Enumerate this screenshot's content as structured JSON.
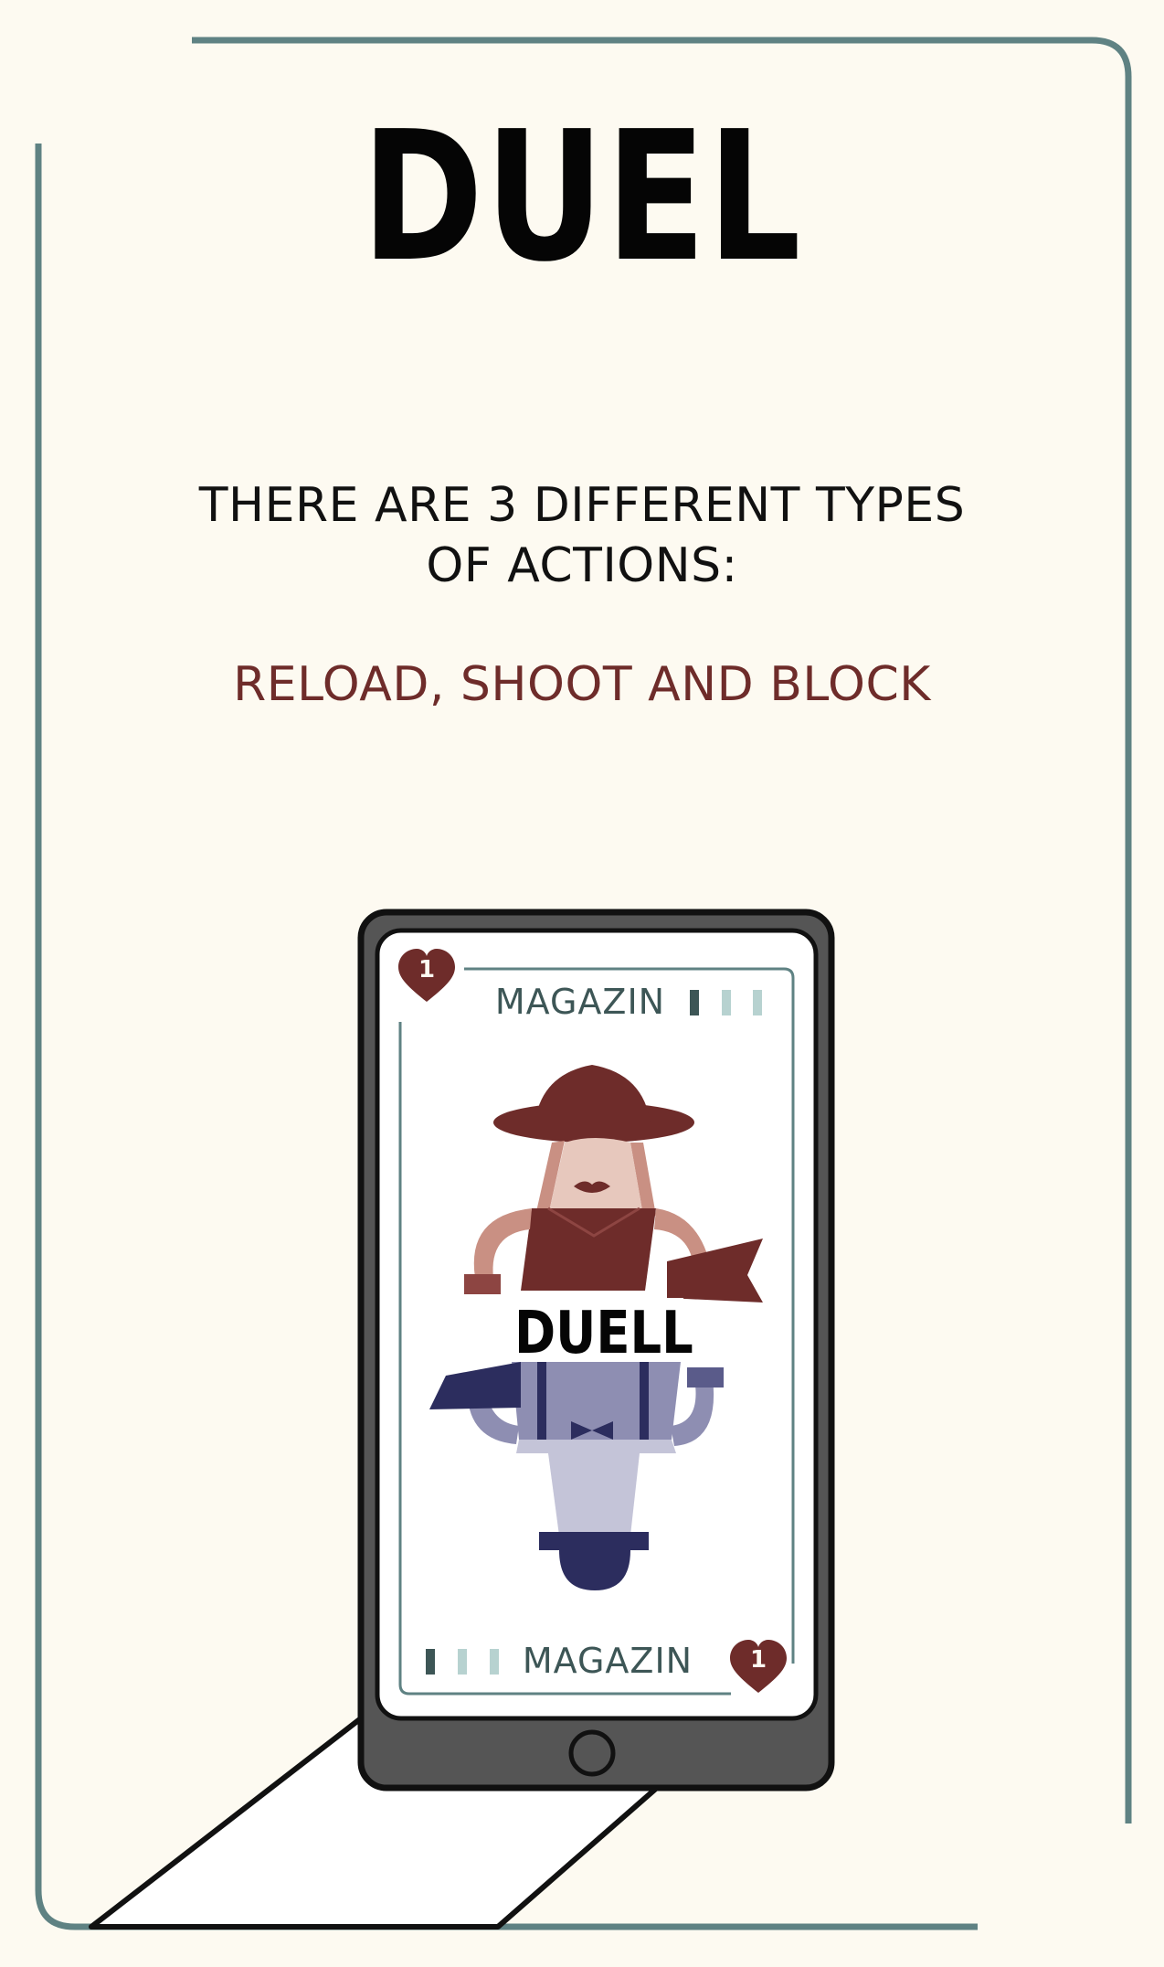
{
  "title": "DUEL",
  "intro_line_1": "THERE ARE 3 DIFFERENT TYPES",
  "intro_line_2": "OF ACTIONS:",
  "actions_line": "RELOAD, SHOOT AND BLOCK",
  "card": {
    "top_label": "MAGAZIN",
    "bottom_label": "MAGAZIN",
    "top_value": "1",
    "bottom_value": "1",
    "logo_text": "DUELL",
    "ammo_filled": 1,
    "ammo_total": 3
  },
  "colors": {
    "frame": "#5f8283",
    "accent_red": "#6e2c2a",
    "navy": "#2c2d5e",
    "background": "#fdfaf1"
  }
}
